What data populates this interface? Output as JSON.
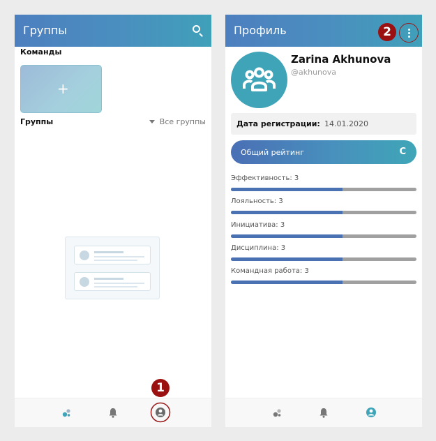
{
  "colors": {
    "accent": "#4a8fbf",
    "teal": "#3fa4b8",
    "callout": "#9b1111",
    "bar_track": "#a0a0a0",
    "bar_fill": "#4a72b2"
  },
  "left_screen": {
    "title": "Группы",
    "teams_heading": "Команды",
    "add_team_icon": "+",
    "groups_heading": "Группы",
    "groups_filter": "Все группы",
    "empty_state_icon": "empty-list-illustration"
  },
  "right_screen": {
    "title": "Профиль",
    "avatar_icon": "group-icon",
    "name": "Zarina Akhunova",
    "handle": "@akhunova",
    "registration_label": "Дата регистрации:",
    "registration_date": "14.01.2020",
    "rating_label": "Общий рейтинг",
    "rating_grade": "C",
    "metrics": [
      {
        "label": "Эффективность: 3",
        "fill": 0.6
      },
      {
        "label": "Лояльность: 3",
        "fill": 0.6
      },
      {
        "label": "Инициатива: 3",
        "fill": 0.6
      },
      {
        "label": "Дисциплина: 3",
        "fill": 0.6
      },
      {
        "label": "Командная работа: 3",
        "fill": 0.6
      }
    ]
  },
  "bottom_nav": {
    "items": [
      {
        "icon": "groups-icon"
      },
      {
        "icon": "bell-icon"
      },
      {
        "icon": "profile-icon"
      }
    ]
  },
  "callouts": {
    "one": "1",
    "two": "2"
  }
}
